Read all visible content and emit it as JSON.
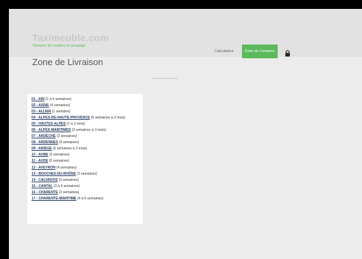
{
  "header": {
    "logo_title": "Taximeuble.com",
    "logo_tagline": "Transport de meubles en groupage",
    "nav": {
      "calculator_label": "Calculateur",
      "zone_label": "Zone de Livraison",
      "lock_icon": "lock-icon"
    }
  },
  "page": {
    "title": "Zone de Livraison"
  },
  "colors": {
    "accent": "#5cb85c",
    "link": "#23395d",
    "background": "#ececec"
  },
  "departments": [
    {
      "code": "01",
      "name": "AIN",
      "delay": "(1 à 4 semaines)"
    },
    {
      "code": "02",
      "name": "AISNE",
      "delay": "(4 semaines)"
    },
    {
      "code": "03",
      "name": "ALLIER",
      "delay": "(1 semaine)"
    },
    {
      "code": "04",
      "name": "ALPES-DE-HAUTE-PROVENCE",
      "delay": "(6 semaines à 3 mois)"
    },
    {
      "code": "05",
      "name": "HAUTES-ALPES",
      "delay": "(2 à 3 mois)"
    },
    {
      "code": "06",
      "name": "ALPES-MARITIMES",
      "delay": "(3 semaines à 3 mois)"
    },
    {
      "code": "07",
      "name": "ARDÈCHE",
      "delay": "(3 semaines)"
    },
    {
      "code": "08",
      "name": "ARDENNES",
      "delay": "(4 semaines)"
    },
    {
      "code": "09",
      "name": "ARIÈGE",
      "delay": "(6 semaines à 3 mois)"
    },
    {
      "code": "10",
      "name": "AUBE",
      "delay": "(5 semaines)"
    },
    {
      "code": "11",
      "name": "AUDE",
      "delay": "(5 semaines)"
    },
    {
      "code": "12",
      "name": "AVEYRON",
      "delay": "(4 semaines)"
    },
    {
      "code": "13",
      "name": "BOUCHES-DU-RHÔNE",
      "delay": "(3 semaines)"
    },
    {
      "code": "14",
      "name": "CALVADOS",
      "delay": "(3 semaines)"
    },
    {
      "code": "15",
      "name": "CANTAL",
      "delay": "(3 à 4 semaines)"
    },
    {
      "code": "16",
      "name": "CHARENTE",
      "delay": "(3 semaines)"
    },
    {
      "code": "17",
      "name": "CHARENTE-MARITIME",
      "delay": "(4 à 6 semaines)"
    }
  ]
}
